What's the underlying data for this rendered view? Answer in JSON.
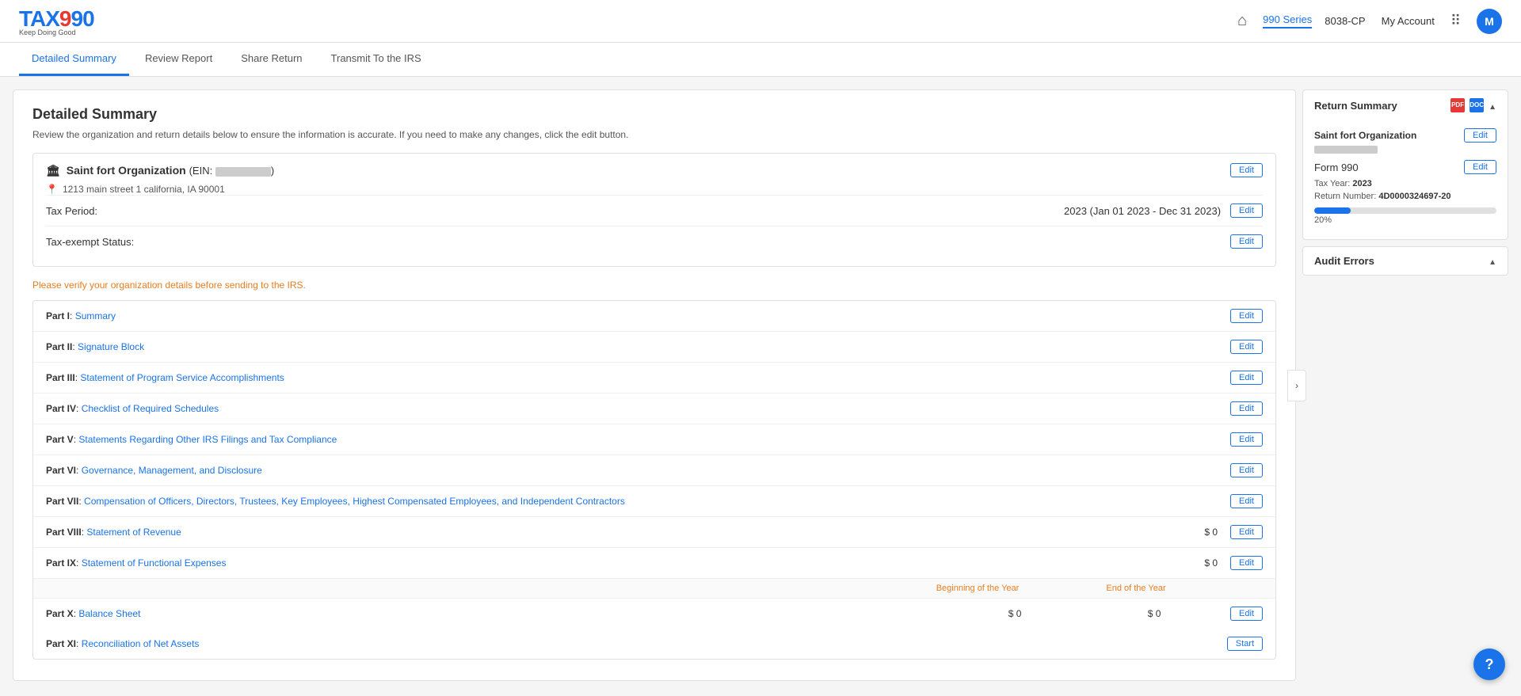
{
  "header": {
    "logo": "TAX990",
    "logo_tagline": "Keep Doing Good",
    "nav": [
      {
        "label": "990 Series",
        "active": true
      },
      {
        "label": "8038-CP",
        "active": false
      }
    ],
    "my_account": "My Account",
    "avatar_letter": "M"
  },
  "tabs": [
    {
      "label": "Detailed Summary",
      "active": true
    },
    {
      "label": "Review Report",
      "active": false
    },
    {
      "label": "Share Return",
      "active": false
    },
    {
      "label": "Transmit To the IRS",
      "active": false
    }
  ],
  "main": {
    "title": "Detailed Summary",
    "subtitle": "Review the organization and return details below to ensure the information is accurate. If you need to make any changes, click the edit button.",
    "org": {
      "name": "Saint fort Organization",
      "ein_prefix": "EIN: ",
      "address": "1213 main street 1 california, IA 90001",
      "tax_period_label": "Tax Period:",
      "tax_period_value": "2023 (Jan 01 2023 - Dec 31 2023)",
      "tax_exempt_label": "Tax-exempt Status:",
      "edit_label": "Edit"
    },
    "verify_notice": "Please verify your organization details before sending to the IRS.",
    "parts": [
      {
        "id": "Part I",
        "label": "Summary",
        "amount": null,
        "balance_bot": null,
        "balance_eoy": null,
        "button": "Edit"
      },
      {
        "id": "Part II",
        "label": "Signature Block",
        "amount": null,
        "balance_bot": null,
        "balance_eoy": null,
        "button": "Edit"
      },
      {
        "id": "Part III",
        "label": "Statement of Program Service Accomplishments",
        "amount": null,
        "balance_bot": null,
        "balance_eoy": null,
        "button": "Edit"
      },
      {
        "id": "Part IV",
        "label": "Checklist of Required Schedules",
        "amount": null,
        "balance_bot": null,
        "balance_eoy": null,
        "button": "Edit"
      },
      {
        "id": "Part V",
        "label": "Statements Regarding Other IRS Filings and Tax Compliance",
        "amount": null,
        "balance_bot": null,
        "balance_eoy": null,
        "button": "Edit"
      },
      {
        "id": "Part VI",
        "label": "Governance, Management, and Disclosure",
        "amount": null,
        "balance_bot": null,
        "balance_eoy": null,
        "button": "Edit"
      },
      {
        "id": "Part VII",
        "label": "Compensation of Officers, Directors, Trustees, Key Employees, Highest Compensated Employees, and Independent Contractors",
        "amount": null,
        "balance_bot": null,
        "balance_eoy": null,
        "button": "Edit"
      },
      {
        "id": "Part VIII",
        "label": "Statement of Revenue",
        "amount": "$ 0",
        "balance_bot": null,
        "balance_eoy": null,
        "button": "Edit"
      },
      {
        "id": "Part IX",
        "label": "Statement of Functional Expenses",
        "amount": "$ 0",
        "balance_bot": null,
        "balance_eoy": null,
        "button": "Edit"
      },
      {
        "id": "Part X",
        "label": "Balance Sheet",
        "amount": null,
        "balance_bot": "$ 0",
        "balance_eoy": "$ 0",
        "balance_header_bot": "Beginning of the Year",
        "balance_header_eoy": "End of the Year",
        "button": "Edit"
      },
      {
        "id": "Part XI",
        "label": "Reconciliation of Net Assets",
        "amount": null,
        "balance_bot": null,
        "balance_eoy": null,
        "button": "Start"
      }
    ]
  },
  "sidebar": {
    "return_summary": {
      "title": "Return Summary",
      "org_name": "Saint fort Organization",
      "form_label": "Form 990",
      "tax_year_label": "Tax Year:",
      "tax_year_value": "2023",
      "return_number_label": "Return Number:",
      "return_number_value": "4D0000324697-20",
      "progress_percent": 20,
      "progress_label": "20%",
      "edit_label": "Edit"
    },
    "audit_errors": {
      "title": "Audit Errors"
    }
  },
  "help": {
    "label": "?"
  }
}
